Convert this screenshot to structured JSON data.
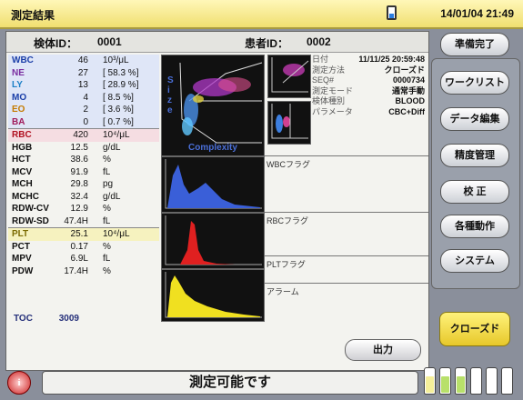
{
  "titlebar": {
    "title": "測定結果",
    "datetime": "14/01/04 21:49",
    "icon": "device-icon"
  },
  "ids": {
    "sample_label": "検体ID：",
    "sample_value": "0001",
    "patient_label": "患者ID：",
    "patient_value": "0002"
  },
  "params": [
    {
      "name": "WBC",
      "value": "46",
      "unit": "10³/μL",
      "hl": "blue",
      "color": "#1a3ea8"
    },
    {
      "name": "NE",
      "value": "27",
      "unit": "[   58.3   %]",
      "hl": "blue",
      "color": "#7a2ea0"
    },
    {
      "name": "LY",
      "value": "13",
      "unit": "[   28.9   %]",
      "hl": "blue",
      "color": "#1a7fc6"
    },
    {
      "name": "MO",
      "value": "4",
      "unit": "[    8.5   %]",
      "hl": "blue",
      "color": "#1a3ea8"
    },
    {
      "name": "EO",
      "value": "2",
      "unit": "[    3.6   %]",
      "hl": "blue",
      "color": "#c47a00"
    },
    {
      "name": "BA",
      "value": "0",
      "unit": "[    0.7   %]",
      "hl": "blue",
      "color": "#a01a5a"
    },
    {
      "name": "RBC",
      "value": "420",
      "unit": "10⁴/μL",
      "hl": "pink",
      "color": "#b01020"
    },
    {
      "name": "HGB",
      "value": "12.5",
      "unit": "g/dL",
      "hl": "",
      "color": "#111"
    },
    {
      "name": "HCT",
      "value": "38.6",
      "unit": "%",
      "hl": "",
      "color": "#111"
    },
    {
      "name": "MCV",
      "value": "91.9",
      "unit": "fL",
      "hl": "",
      "color": "#111"
    },
    {
      "name": "MCH",
      "value": "29.8",
      "unit": "pg",
      "hl": "",
      "color": "#111"
    },
    {
      "name": "MCHC",
      "value": "32.4",
      "unit": "g/dL",
      "hl": "",
      "color": "#111"
    },
    {
      "name": "RDW-CV",
      "value": "12.9",
      "unit": "%",
      "hl": "",
      "color": "#111"
    },
    {
      "name": "RDW-SD",
      "value": "47.4H",
      "unit": "fL",
      "hl": "",
      "color": "#111"
    },
    {
      "name": "PLT",
      "value": "25.1",
      "unit": "10⁴/μL",
      "hl": "yellow",
      "color": "#7a6a00"
    },
    {
      "name": "PCT",
      "value": "0.17",
      "unit": "%",
      "hl": "",
      "color": "#111"
    },
    {
      "name": "MPV",
      "value": "6.9L",
      "unit": "fL",
      "hl": "",
      "color": "#111"
    },
    {
      "name": "PDW",
      "value": "17.4H",
      "unit": "%",
      "hl": "",
      "color": "#111"
    }
  ],
  "toc": {
    "label": "TOC",
    "value": "3009"
  },
  "scatter": {
    "y_label": "Size",
    "x_label": "Complexity"
  },
  "info": [
    {
      "k": "日付",
      "v": "11/11/25 20:59:48"
    },
    {
      "k": "測定方法",
      "v": "クローズド"
    },
    {
      "k": "SEQ#",
      "v": "0000734"
    },
    {
      "k": "測定モード",
      "v": "通常手動"
    },
    {
      "k": "検体種別",
      "v": "BLOOD"
    },
    {
      "k": "パラメータ",
      "v": "CBC+Diff"
    }
  ],
  "flags": {
    "wbc": "WBCフラグ",
    "rbc": "RBCフラグ",
    "plt": "PLTフラグ",
    "alarm": "アラーム"
  },
  "buttons": {
    "output": "出力",
    "ready": "準備完了",
    "worklist": "ワークリスト",
    "data_edit": "データ編集",
    "qc": "精度管理",
    "calibration": "校 正",
    "operations": "各種動作",
    "system": "システム",
    "closed": "クローズド"
  },
  "status": {
    "message": "測定可能です",
    "info_glyph": "i"
  },
  "reagents": [
    "#f5ef9a",
    "#b8e06a",
    "#b8e06a",
    "#ffffff",
    "#ffffff",
    "#ffffff"
  ]
}
